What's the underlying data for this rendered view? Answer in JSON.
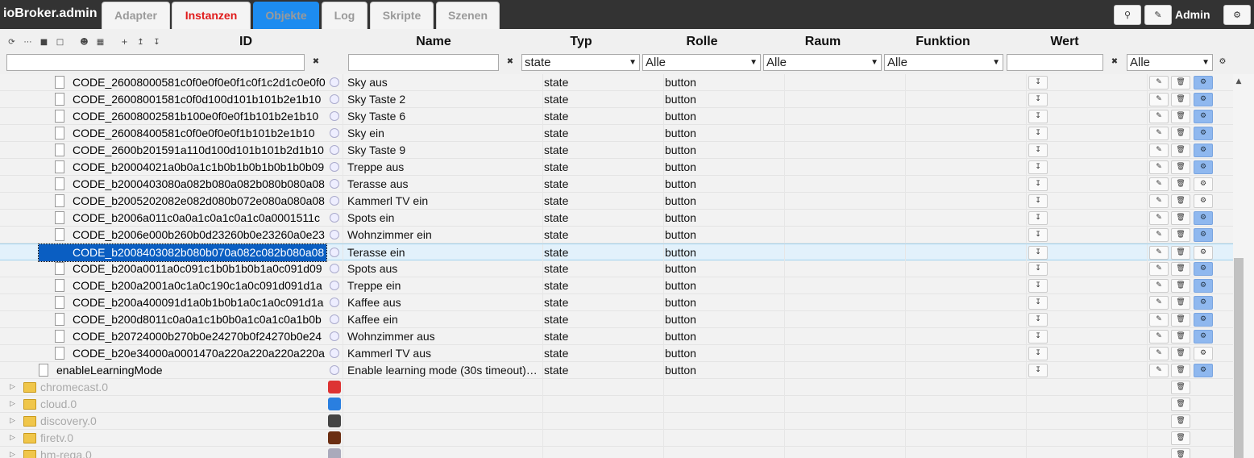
{
  "brand": "ioBroker.admin",
  "tabs": [
    {
      "label": "Adapter",
      "color": "#1a9a1a"
    },
    {
      "label": "Instanzen",
      "color": "#9a9a9a"
    },
    {
      "label": "Objekte",
      "color": "#ffffff"
    },
    {
      "label": "Log",
      "color": "#e01b1b"
    },
    {
      "label": "Skripte",
      "color": "#9a9a9a"
    },
    {
      "label": "Szenen",
      "color": "#9a9a9a"
    }
  ],
  "active_tab": "Objekte",
  "header_buttons": {
    "search_icon": "search-icon",
    "edit_icon": "pencil-icon",
    "settings_icon": "gear-icon"
  },
  "user": "Admin",
  "columns": {
    "id": "ID",
    "name": "Name",
    "typ": "Typ",
    "rolle": "Rolle",
    "raum": "Raum",
    "funktion": "Funktion",
    "wert": "Wert"
  },
  "filters": {
    "id": "",
    "name": "",
    "typ": "state",
    "rolle": "Alle",
    "raum": "Alle",
    "funktion": "Alle",
    "wert": "",
    "extra": "Alle"
  },
  "rows": [
    {
      "id": "CODE_26008000581c0f0e0f0e0f1c0f1c2d1c0e0f0",
      "name": "Sky aus",
      "typ": "state",
      "rolle": "button",
      "gear_blue": true
    },
    {
      "id": "CODE_26008001581c0f0d100d101b101b2e1b10",
      "name": "Sky Taste 2",
      "typ": "state",
      "rolle": "button",
      "gear_blue": true
    },
    {
      "id": "CODE_26008002581b100e0f0e0f1b101b2e1b10",
      "name": "Sky Taste 6",
      "typ": "state",
      "rolle": "button",
      "gear_blue": true
    },
    {
      "id": "CODE_26008400581c0f0e0f0e0f1b101b2e1b10",
      "name": "Sky ein",
      "typ": "state",
      "rolle": "button",
      "gear_blue": true
    },
    {
      "id": "CODE_2600b201591a110d100d101b101b2d1b10",
      "name": "Sky Taste 9",
      "typ": "state",
      "rolle": "button",
      "gear_blue": true
    },
    {
      "id": "CODE_b20004021a0b0a1c1b0b1b0b1b0b1b0b09",
      "name": "Treppe aus",
      "typ": "state",
      "rolle": "button",
      "gear_blue": true
    },
    {
      "id": "CODE_b2000403080a082b080a082b080b080a08",
      "name": "Terasse aus",
      "typ": "state",
      "rolle": "button",
      "gear_blue": false
    },
    {
      "id": "CODE_b2005202082e082d080b072e080a080a08",
      "name": "Kammerl TV ein",
      "typ": "state",
      "rolle": "button",
      "gear_blue": false
    },
    {
      "id": "CODE_b2006a011c0a0a1c0a1c0a1c0a0001511c",
      "name": "Spots ein",
      "typ": "state",
      "rolle": "button",
      "gear_blue": true
    },
    {
      "id": "CODE_b2006e000b260b0d23260b0e23260a0e23",
      "name": "Wohnzimmer ein",
      "typ": "state",
      "rolle": "button",
      "gear_blue": true
    },
    {
      "id": "CODE_b2008403082b080b070a082c082b080a08",
      "name": "Terasse ein",
      "typ": "state",
      "rolle": "button",
      "gear_blue": false,
      "selected": true
    },
    {
      "id": "CODE_b200a0011a0c091c1b0b1b0b1a0c091d09",
      "name": "Spots aus",
      "typ": "state",
      "rolle": "button",
      "gear_blue": true
    },
    {
      "id": "CODE_b200a2001a0c1a0c190c1a0c091d091d1a",
      "name": "Treppe ein",
      "typ": "state",
      "rolle": "button",
      "gear_blue": true
    },
    {
      "id": "CODE_b200a400091d1a0b1b0b1a0c1a0c091d1a",
      "name": "Kaffee aus",
      "typ": "state",
      "rolle": "button",
      "gear_blue": true
    },
    {
      "id": "CODE_b200d8011c0a0a1c1b0b0a1c0a1c0a1b0b",
      "name": "Kaffee ein",
      "typ": "state",
      "rolle": "button",
      "gear_blue": true
    },
    {
      "id": "CODE_b20724000b270b0e24270b0f24270b0e24",
      "name": "Wohnzimmer aus",
      "typ": "state",
      "rolle": "button",
      "gear_blue": true
    },
    {
      "id": "CODE_b20e34000a0001470a220a220a220a220a",
      "name": "Kammerl TV aus",
      "typ": "state",
      "rolle": "button",
      "gear_blue": false
    },
    {
      "id": "enableLearningMode",
      "name": "Enable learning mode (30s timeout)…",
      "typ": "state",
      "rolle": "button",
      "gear_blue": true,
      "level": 1
    }
  ],
  "adapters": [
    {
      "id": "chromecast.0",
      "icon": "chromecast-icon",
      "icon_color": "#d33"
    },
    {
      "id": "cloud.0",
      "icon": "cloud-icon",
      "icon_color": "#2a7fe0"
    },
    {
      "id": "discovery.0",
      "icon": "binoculars-icon",
      "icon_color": "#444"
    },
    {
      "id": "firetv.0",
      "icon": "firetv-icon",
      "icon_color": "#6b2e12"
    },
    {
      "id": "hm-rega.0",
      "icon": "homematic-icon",
      "icon_color": "#aab"
    }
  ]
}
